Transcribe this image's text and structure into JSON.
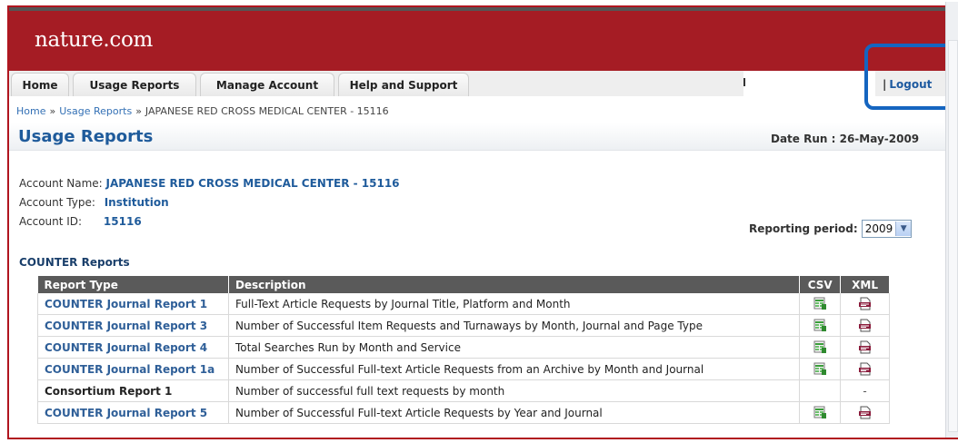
{
  "header": {
    "brand": "nature.com"
  },
  "nav": {
    "tabs": [
      "Home",
      "Usage Reports",
      "Manage Account",
      "Help and Support"
    ],
    "logout_sep": "|",
    "logout": "Logout"
  },
  "breadcrumb": {
    "items": [
      "Home",
      "Usage Reports",
      "JAPANESE RED CROSS MEDICAL CENTER - 15116"
    ],
    "separator": "»"
  },
  "page": {
    "title": "Usage Reports",
    "date_run": "Date Run : 26-May-2009"
  },
  "account": {
    "name_label": "Account Name:",
    "name_value": "JAPANESE RED CROSS MEDICAL CENTER - 15116",
    "type_label": "Account Type:",
    "type_value": "Institution",
    "id_label": "Account ID:",
    "id_value": "15116"
  },
  "reporting_period": {
    "label": "Reporting period:",
    "selected": "2009"
  },
  "section": {
    "title": "COUNTER Reports"
  },
  "table": {
    "headers": [
      "Report Type",
      "Description",
      "CSV",
      "XML"
    ],
    "rows": [
      {
        "type": "COUNTER Journal Report 1",
        "desc": "Full-Text Article Requests by Journal Title, Platform and Month",
        "csv": "csv-icon",
        "xml": "xml-icon"
      },
      {
        "type": "COUNTER Journal Report 3",
        "desc": "Number of Successful Item Requests and Turnaways by Month, Journal and Page Type",
        "csv": "csv-icon",
        "xml": "xml-icon"
      },
      {
        "type": "COUNTER Journal Report 4",
        "desc": "Total Searches Run by Month and Service",
        "csv": "csv-icon",
        "xml": "xml-icon"
      },
      {
        "type": "COUNTER Journal Report 1a",
        "desc": "Number of Successful Full-text Article Requests from an Archive by Month and Journal",
        "csv": "csv-icon",
        "xml": "xml-icon"
      },
      {
        "type": "Consortium Report 1",
        "desc": "Number of successful full text requests by month",
        "csv": "",
        "xml": "-"
      },
      {
        "type": "COUNTER Journal Report 5",
        "desc": "Number of Successful Full-text Article Requests by Year and Journal",
        "csv": "csv-icon",
        "xml": "xml-icon"
      }
    ]
  },
  "colors": {
    "brand_red": "#a51c24",
    "link_blue": "#1f5b9b",
    "highlight": "#1565c0",
    "table_header": "#5a5a5a"
  }
}
